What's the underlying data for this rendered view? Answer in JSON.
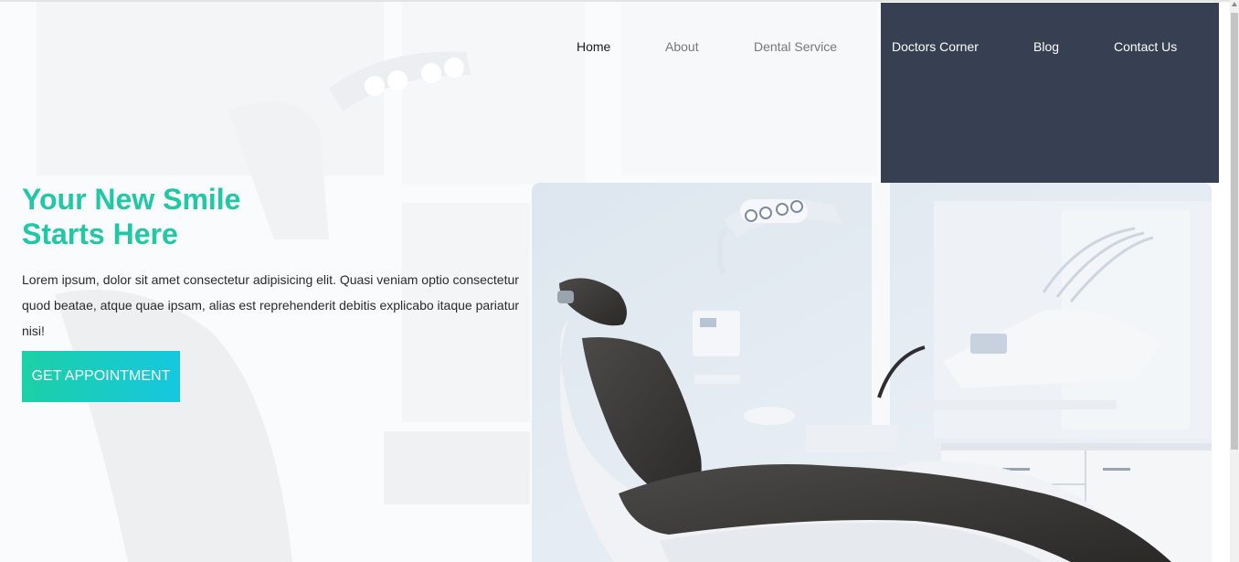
{
  "nav": {
    "items": [
      {
        "label": "Home",
        "tone": "dark"
      },
      {
        "label": "About",
        "tone": "grey"
      },
      {
        "label": "Dental Service",
        "tone": "grey"
      },
      {
        "label": "Doctors Corner",
        "tone": "light"
      },
      {
        "label": "Blog",
        "tone": "light"
      },
      {
        "label": "Contact Us",
        "tone": "light"
      }
    ]
  },
  "hero": {
    "title_line1": "Your New Smile",
    "title_line2": "Starts Here",
    "description": "Lorem ipsum, dolor sit amet consectetur adipisicing elit. Quasi veniam optio consectetur quod beatae, atque quae ipsam, alias est reprehenderit debitis explicabo itaque pariatur nisi!",
    "cta_label": "GET APPOINTMENT"
  },
  "colors": {
    "accent": "#20c8a6",
    "accent_gradient_end": "#16c7e0",
    "dark_panel": "#373f52",
    "text": "#2a2a2a"
  },
  "icons": [
    "dental-chair-photo",
    "scrollbar-up-arrow"
  ]
}
